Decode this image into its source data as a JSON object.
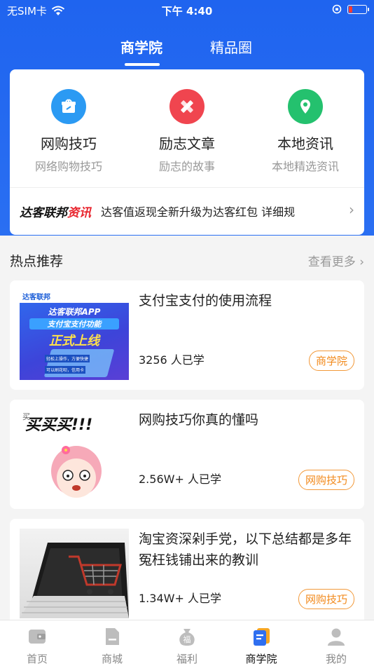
{
  "status_bar": {
    "carrier": "无SIM卡",
    "time": "下午 4:40"
  },
  "top_tabs": [
    {
      "label": "商学院",
      "active": true
    },
    {
      "label": "精品圈",
      "active": false
    }
  ],
  "categories": [
    {
      "title": "网购技巧",
      "subtitle": "网络购物技巧",
      "icon": "gift-box-icon",
      "color": "#2b9af3"
    },
    {
      "title": "励志文章",
      "subtitle": "励志的故事",
      "icon": "pencil-ruler-icon",
      "color": "#f0454f"
    },
    {
      "title": "本地资讯",
      "subtitle": "本地精选资讯",
      "icon": "location-pin-icon",
      "color": "#24c16e"
    }
  ],
  "news": {
    "logo_prefix": "达客联邦",
    "logo_suffix": "资讯",
    "text": "达客值返现全新升级为达客红包 详细规"
  },
  "hot": {
    "title": "热点推荐",
    "more": "查看更多"
  },
  "articles": [
    {
      "title": "支付宝支付的使用流程",
      "count": "3256 人已学",
      "tag": "商学院",
      "thumb": {
        "brand": "达客联邦",
        "line1": "达客联邦APP",
        "line2": "支付宝支付功能",
        "line3": "正式上线",
        "note1": "轻松上操作，方便快捷",
        "note2": "可以刷花呗，信用卡"
      }
    },
    {
      "title": "网购技巧你真的懂吗",
      "count": "2.56W+ 人已学",
      "tag": "网购技巧",
      "thumb": {
        "headline": "买买买!!!",
        "word": "买"
      }
    },
    {
      "title": "淘宝资深剁手党，以下总结都是多年冤枉钱铺出来的教训",
      "count": "1.34W+ 人已学",
      "tag": "网购技巧"
    }
  ],
  "tab_bar": [
    {
      "label": "首页",
      "icon": "home-wallet-icon",
      "active": false
    },
    {
      "label": "商城",
      "icon": "document-icon",
      "active": false
    },
    {
      "label": "福利",
      "icon": "fortune-bag-icon",
      "active": false
    },
    {
      "label": "商学院",
      "icon": "academy-icon",
      "active": true
    },
    {
      "label": "我的",
      "icon": "user-icon",
      "active": false
    }
  ]
}
